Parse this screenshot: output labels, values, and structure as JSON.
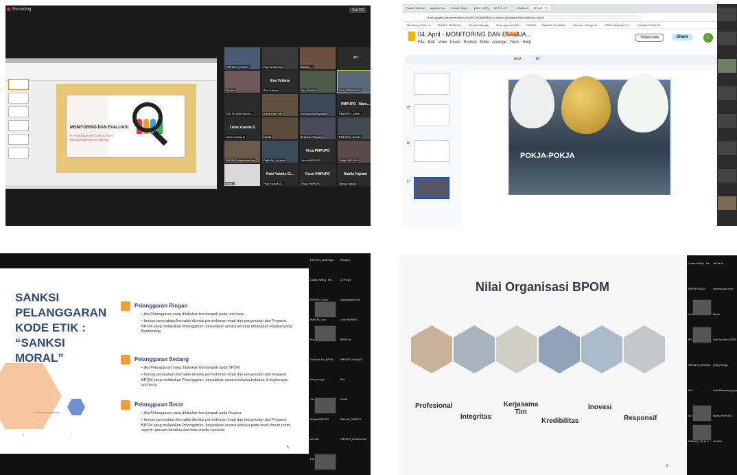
{
  "q1": {
    "recording": "Recording",
    "exit": "Exit CS",
    "ppt_slide_title": "MONITORING DAN EVALUASI",
    "ppt_slide_sub1": "P. PEMBINAAN INTEGRITAS DAN",
    "ppt_slide_sub2": "PELAYANAN PUBLIK KINERJA",
    "tiles": [
      {
        "name": "PMPUPO_Ersta K.",
        "big": ""
      },
      {
        "name": "Fajr 11 Windayu",
        "big": ""
      },
      {
        "name": "Kartini_...",
        "big": ""
      },
      {
        "name": "",
        "big": "eri"
      },
      {
        "name": "Dini Ani",
        "big": ""
      },
      {
        "name": "Eva Yuliana",
        "big": "Eva Yuliana"
      },
      {
        "name": "Iina_Pratiwi",
        "big": ""
      },
      {
        "name": "Rini_ERPMPUPO",
        "big": ""
      },
      {
        "name": "SFD Pt_Dini Sanuth...",
        "big": ""
      },
      {
        "name": "Windi Eka Putri",
        "big": ""
      },
      {
        "name": "Ati Nanda Widyastuti",
        "big": ""
      },
      {
        "name": "PMPUPO - Marc...",
        "big": "PMPUPO - Marc..."
      },
      {
        "name": "Lisha Yusetia S",
        "big": "Lisha Yusetia S"
      },
      {
        "name": "Novita",
        "big": ""
      },
      {
        "name": "D.Lianto Yaspang",
        "big": ""
      },
      {
        "name": "PMPUPO_Sandi...",
        "big": ""
      },
      {
        "name": "BPOM_Pangkanbarong",
        "big": ""
      },
      {
        "name": "Galih Nu_Zuriyah",
        "big": ""
      },
      {
        "name": "Virza PMPUPO",
        "big": "Virza PMPUPO"
      },
      {
        "name": "Shitfy PMPUPO",
        "big": ""
      },
      {
        "name": "Yoga...",
        "big": ""
      },
      {
        "name": "Patri Yulrida Gi...",
        "big": "Patri Yulrida Gi..."
      },
      {
        "name": "Fauzi PMPUPO",
        "big": "Fauzi PMPUPO"
      },
      {
        "name": "Nabila Fajriani",
        "big": "Nabila Fajriani"
      }
    ]
  },
  "q2": {
    "tabs": [
      "Pusat Infomasi",
      "Layanan Ins...",
      "Dhoammpup...",
      "2023 - Detly",
      "00 Fed - Hl",
      "",
      "05 Absen",
      "04 April - Ri"
    ],
    "url": "docs.google.com/presentation/d/1l2kF7HKBjoPDNkz7k_C0ymLpiDuzjlmm2Bo/edit#slide=id.p16",
    "bookmarks": [
      "Monitoring Tukin di...",
      "MONEY TRANLAH...",
      "Direktoratpengu...",
      "Buku Agenda KPA...",
      "DIGPAY",
      "Data Diri Pendaftar...",
      "Absensi - Google D...",
      "KPPN Jakarta VI (Li...",
      "Petunjuk Teknis SA..."
    ],
    "title": "04. April - MONITORING DAN EVALUA...",
    "pptx": ".PPTX",
    "menu": "File Edit View Insert Format Slide Arrange Tools Help",
    "slideshow": "Slideshow",
    "share": "Share",
    "avatar": "L",
    "font": "Arial",
    "size": "18",
    "slide_nums": [
      "15",
      "16",
      "17"
    ],
    "slide_text": "POKJA-POKJA"
  },
  "q3": {
    "title": "SANKSI\nPELANGGARAN\nKODE ETIK :\n“SANKSI\nMORAL”",
    "ringan_h": "Pelanggaran Ringan",
    "ringan_1": "•  jika Pelanggaran yang dilakukan berdampak pada unit kerja",
    "ringan_2": "•  berupa pernyataan bersalah disertai permohonan maaf dan penyesalan dari Pegawai BPOM yang melakukan Pelanggaran, dinyatakan secara tertutup dihadapan Pejabat yang Berwenang",
    "sedang_h": "Pelanggaran Sedang",
    "sedang_1": "•  jika Pelanggaran yang dilakukan berdampak pada BPOM",
    "sedang_2": "•  berupa pernyataan bersalah disertai permohonan maaf dan penyesalan dari Pegawai BPOM yang melakukan Pelanggaran, dinyatakan secara terbuka terbatas di lingkungan unit kerja",
    "berat_h": "Pelanggaran Berat",
    "berat_1": "•  jika Pelanggaran yang dilakukan berdampak pada Negara.",
    "berat_2": "•  berupa pernyataan bersalah disertai permohonan maaf dan penyesalan dari Pegawai BPOM yang melakukan Pelanggaran, dinyatakan secara terbuka pada suatu forum resmi seperti upacara bendera dan/atau media nasional.",
    "page": "5",
    "gallery": [
      "PMPUPO_Dani Riyan",
      "Eka Ayin",
      "Lusiana Widyo - Pa...",
      "Lili Purba",
      "PMPUPO_Fauzi",
      "Indramayudin Irvin",
      "PMPUPO_sati",
      "Lorfy_PMPUPO",
      "Ruyun",
      "BPOM Ita",
      "Anita Nur Aini_BPOM",
      "PMPUPO_SandfyDJ",
      "Irma_pmpupo",
      "Red",
      "Yanti Rahasari_pmpupo",
      "Novita",
      "Nindya PMPUPO",
      "Rahmah_PMPUPO",
      "ami time",
      "PMPUPO_Siti Rochmah",
      "Lisha Yusetia S"
    ]
  },
  "q4": {
    "title": "Nilai Organisasi BPOM",
    "values": [
      "Profesional",
      "Integritas",
      "Kerjasama Tim",
      "Kredibilitas",
      "Inovasi",
      "Responsif"
    ],
    "page": "3",
    "gallery": [
      "Lusiana Widyo - Pa...",
      "Lili Purba",
      "PMPUPO Fauzi",
      "Indramayudin Irvin",
      "Lorfy_PMPUPO",
      "Ruyun",
      "BPOM Ita",
      "Anita Nur Aini_BPOM",
      "PMPUPO_SandfyDJ",
      "Irma_pmpupo",
      "Red",
      "Yanti Rahasari_pmpupo",
      "Novita",
      "Nindya PMPUPO",
      "Rahmah_PMPUPO",
      "ami time"
    ]
  }
}
